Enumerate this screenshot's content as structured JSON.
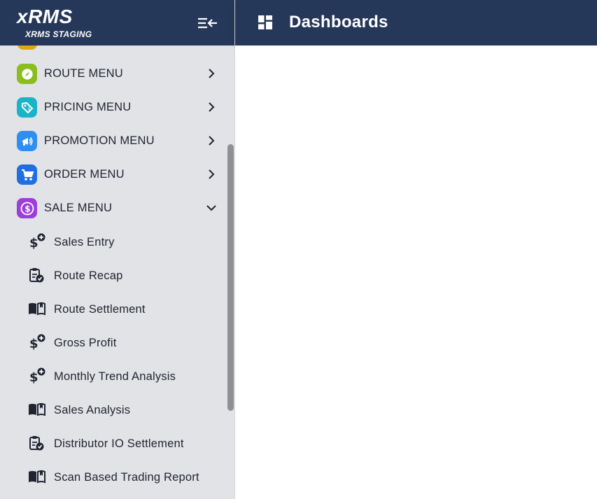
{
  "brand": {
    "title": "xRMS",
    "subtitle": "XRMS STAGING"
  },
  "header": {
    "title": "Dashboards"
  },
  "menu": {
    "items": [
      {
        "label": "ROUTE MENU",
        "icon": "compass-icon",
        "color": "#8bbd1e",
        "expanded": false
      },
      {
        "label": "PRICING MENU",
        "icon": "price-tag-icon",
        "color": "#1bb3c8",
        "expanded": false
      },
      {
        "label": "PROMOTION MENU",
        "icon": "megaphone-icon",
        "color": "#2e8ff0",
        "expanded": false
      },
      {
        "label": "ORDER MENU",
        "icon": "cart-icon",
        "color": "#1f6fe0",
        "expanded": false
      },
      {
        "label": "SALE MENU",
        "icon": "dollar-icon",
        "color": "#9b3fd8",
        "expanded": true
      }
    ],
    "sale_sub_items": [
      {
        "label": "Sales Entry",
        "icon": "dollar-plus-icon"
      },
      {
        "label": "Route Recap",
        "icon": "clipboard-check-icon"
      },
      {
        "label": "Route Settlement",
        "icon": "book-open-icon"
      },
      {
        "label": "Gross Profit",
        "icon": "dollar-plus-icon"
      },
      {
        "label": "Monthly Trend Analysis",
        "icon": "dollar-plus-icon"
      },
      {
        "label": "Sales Analysis",
        "icon": "book-open-icon"
      },
      {
        "label": "Distributor IO Settlement",
        "icon": "clipboard-check-icon"
      },
      {
        "label": "Scan Based Trading Report",
        "icon": "book-open-icon"
      }
    ]
  },
  "colors": {
    "header_bg": "#263859",
    "sidebar_bg": "#e2e3e7",
    "scrollbar": "#8f9093"
  }
}
